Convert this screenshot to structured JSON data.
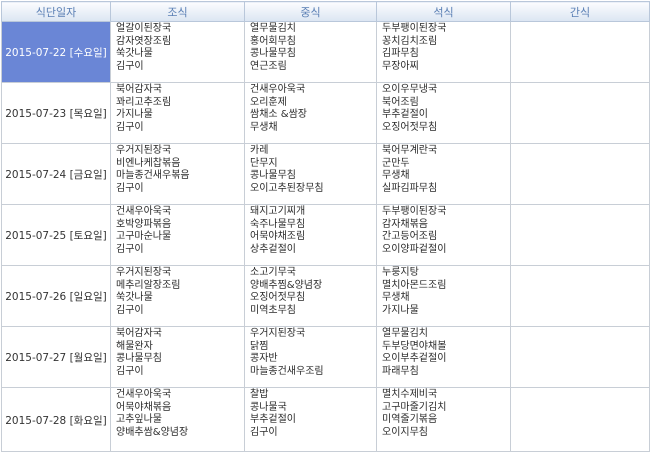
{
  "headers": [
    "식단일자",
    "조식",
    "중식",
    "석식",
    "간식"
  ],
  "rows": [
    {
      "date": "2015-07-22 [수요일]",
      "breakfast": [
        "얼갈이된장국",
        "감자엿장조림",
        "쑥갓나물",
        "김구이"
      ],
      "lunch": [
        "열무물김치",
        "홍어회무침",
        "콩나물무침",
        "연근조림"
      ],
      "dinner": [
        "두부팽이된장국",
        "꽁치김치조림",
        "김파무침",
        "무장아찌"
      ],
      "snack": []
    },
    {
      "date": "2015-07-23 [목요일]",
      "breakfast": [
        "북어감자국",
        "꽈리고추조림",
        "가지나물",
        "김구이"
      ],
      "lunch": [
        "건새우아욱국",
        "오리훈제",
        "쌈채소 &쌈장",
        "무생채"
      ],
      "dinner": [
        "오이우무냉국",
        "북어조림",
        "부추겉절이",
        "오징어젓무침"
      ],
      "snack": []
    },
    {
      "date": "2015-07-24 [금요일]",
      "breakfast": [
        "우거지된장국",
        "비엔나케찹볶음",
        "마늘종건새우볶음",
        "김구이"
      ],
      "lunch": [
        "카레",
        "단무지",
        "콩나물무침",
        "오이고추된장무침"
      ],
      "dinner": [
        "북어무계란국",
        "군만두",
        "무생채",
        "실파김파무침"
      ],
      "snack": []
    },
    {
      "date": "2015-07-25 [토요일]",
      "breakfast": [
        "건새우아욱국",
        "호박양파볶음",
        "고구마순나물",
        "김구이"
      ],
      "lunch": [
        "돼지고기찌개",
        "숙주나물무침",
        "어묵야채조림",
        "상추겉절이"
      ],
      "dinner": [
        "두부팽이된장국",
        "감자채볶음",
        "간고등어조림",
        "오이양파겉절이"
      ],
      "snack": []
    },
    {
      "date": "2015-07-26 [일요일]",
      "breakfast": [
        "우거지된장국",
        "메추리알장조림",
        "쑥갓나물",
        "김구이"
      ],
      "lunch": [
        "소고기무국",
        "양배추찜&양념장",
        "오징어젓무침",
        "미역초무침"
      ],
      "dinner": [
        "누룽지탕",
        "멸치아몬드조림",
        "무생채",
        "가지나물"
      ],
      "snack": []
    },
    {
      "date": "2015-07-27 [월요일]",
      "breakfast": [
        "북어감자국",
        "해물완자",
        "콩나물무침",
        "김구이"
      ],
      "lunch": [
        "우거지된장국",
        "닭찜",
        "콩자반",
        "마늘종건새우조림"
      ],
      "dinner": [
        "열무물김치",
        "두부당면야채볼",
        "오이부추겉절이",
        "파래무침"
      ],
      "snack": []
    },
    {
      "date": "2015-07-28 [화요일]",
      "breakfast": [
        "건새우아욱국",
        "어묵야채볶음",
        "고추잎나물",
        "양배추쌈&양념장"
      ],
      "lunch": [
        "찰밥",
        "콩나물국",
        "부추겉절이",
        "김구이"
      ],
      "dinner": [
        "멸치수제비국",
        "고구마줄기김치",
        "미역줄기볶음",
        "오이지무침"
      ],
      "snack": []
    }
  ],
  "selected_index": 0,
  "colors": {
    "header_text": "#5a7fb4",
    "selected_bg": "#6a86d6",
    "border": "#c8ced6"
  }
}
